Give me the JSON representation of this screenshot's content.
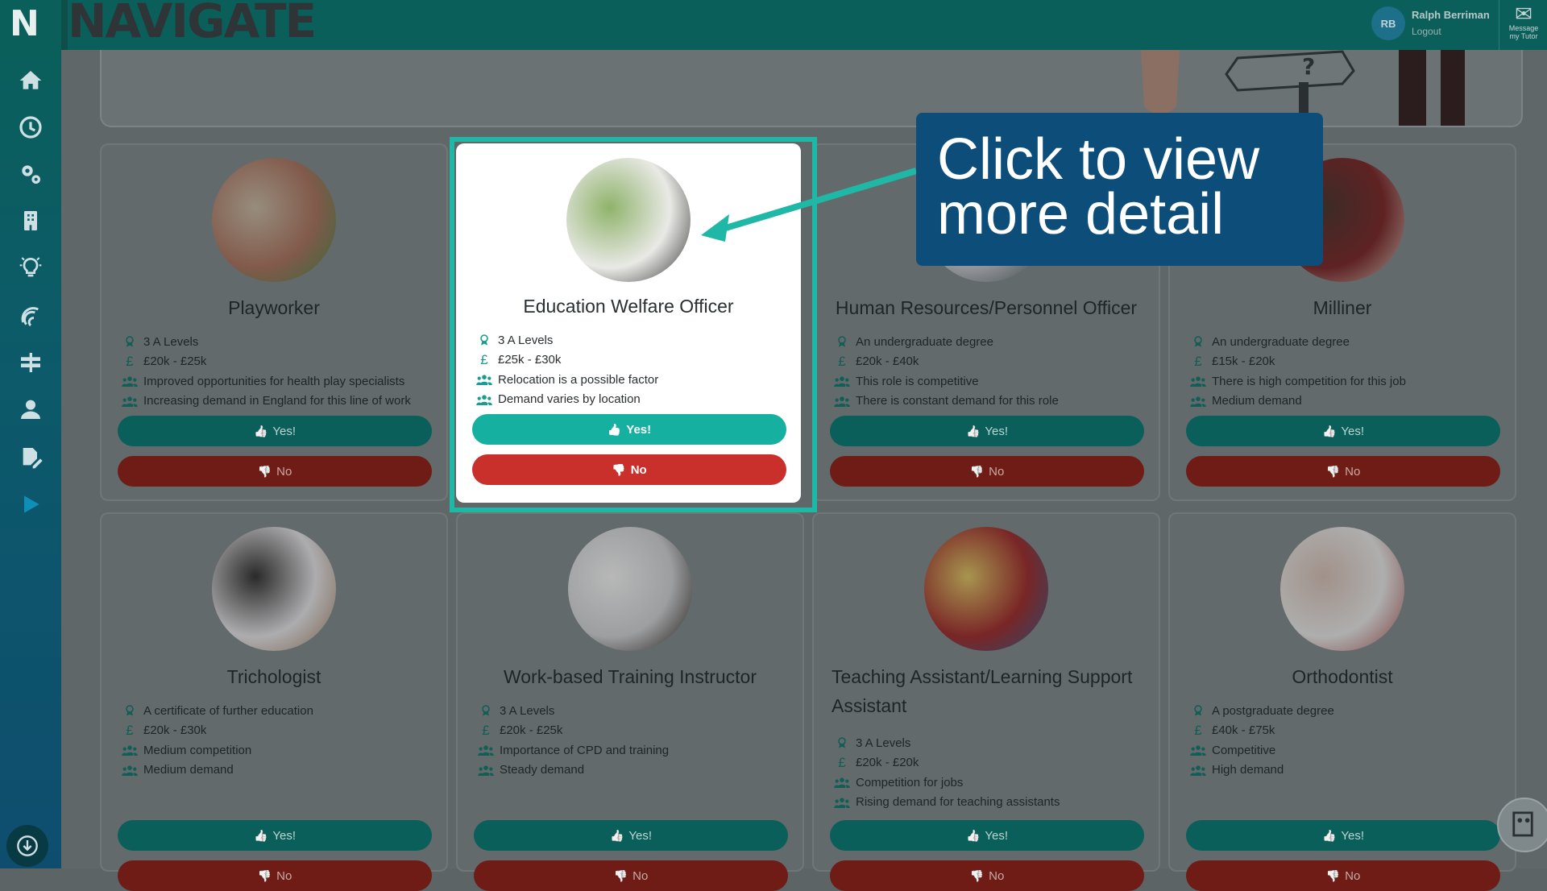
{
  "app": {
    "logo_letter": "N",
    "brand": "NAVIGATE"
  },
  "user": {
    "initials": "RB",
    "name": "Ralph Berriman",
    "logout": "Logout"
  },
  "messages": {
    "label_line1": "Message",
    "label_line2": "my Tutor"
  },
  "sidebar": {
    "items": [
      {
        "icon": "home-icon"
      },
      {
        "icon": "clock-icon"
      },
      {
        "icon": "gears-icon"
      },
      {
        "icon": "building-icon"
      },
      {
        "icon": "lightbulb-icon"
      },
      {
        "icon": "fingerprint-icon"
      },
      {
        "icon": "signpost-icon"
      },
      {
        "icon": "user-icon"
      },
      {
        "icon": "edit-file-icon"
      },
      {
        "icon": "play-icon"
      }
    ],
    "bottom_icon": "download-icon"
  },
  "callout": {
    "line1": "Click to view",
    "line2": "more detail"
  },
  "buttons": {
    "yes": "Yes!",
    "no": "No"
  },
  "cards": [
    {
      "title": "Playworker",
      "rows": [
        "3 A Levels",
        "£20k - £25k",
        "Improved opportunities for health play specialists",
        "Increasing demand in England for this line of work"
      ]
    },
    {
      "title": "Education Welfare Officer",
      "rows": [
        "3 A Levels",
        "£25k - £30k",
        "Relocation is a possible factor",
        "Demand varies by location"
      ]
    },
    {
      "title": "Human Resources/Personnel Officer",
      "rows": [
        "An undergraduate degree",
        "£20k - £40k",
        "This role is competitive",
        "There is constant demand for this role"
      ]
    },
    {
      "title": "Milliner",
      "rows": [
        "An undergraduate degree",
        "£15k - £20k",
        "There is high competition for this job",
        "Medium demand"
      ]
    },
    {
      "title": "Trichologist",
      "rows": [
        "A certificate of further education",
        "£20k - £30k",
        "Medium competition",
        "Medium demand"
      ]
    },
    {
      "title": "Work-based Training Instructor",
      "rows": [
        "3 A Levels",
        "£20k - £25k",
        "Importance of CPD and training",
        "Steady demand"
      ]
    },
    {
      "title_line1": "Teaching Assistant/Learning Support",
      "title_line2": "Assistant",
      "rows": [
        "3 A Levels",
        "£20k - £20k",
        "Competition for jobs",
        "Rising demand for teaching assistants"
      ]
    },
    {
      "title": "Orthodontist",
      "rows": [
        "A postgraduate degree",
        "£40k - £75k",
        "Competitive",
        "High demand"
      ]
    }
  ],
  "row_icons": [
    "award-icon",
    "pound-icon",
    "users-icon",
    "users-icon"
  ],
  "colors": {
    "header": "#0a5f5b",
    "highlight": "#1fb8a6",
    "callout": "#0d4d7a",
    "yes_active": "#16b0a0",
    "no_active": "#c9302c"
  }
}
